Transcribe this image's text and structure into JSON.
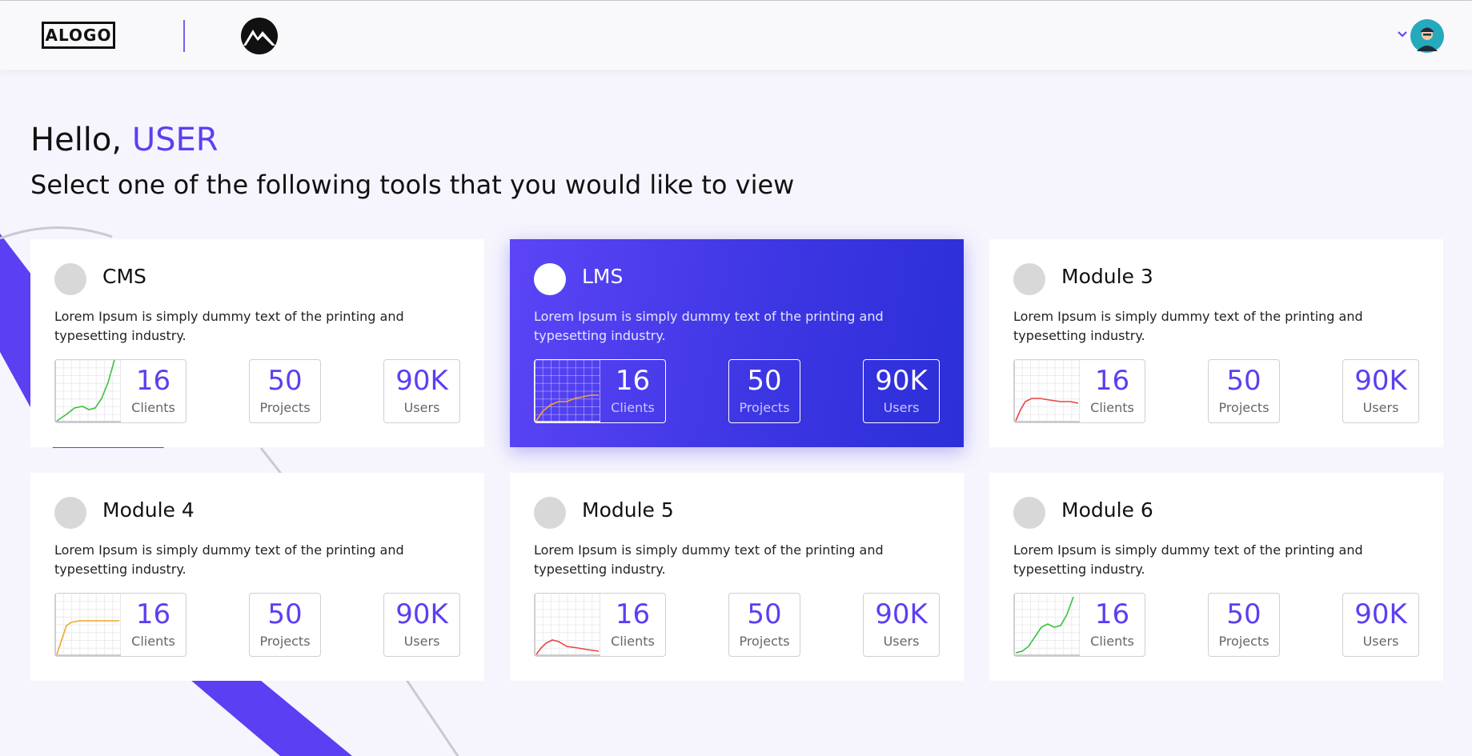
{
  "header": {
    "logo_text": "ALOGO",
    "icons": [
      "mountain-logo-icon",
      "chevron-down-icon",
      "user-avatar-icon"
    ]
  },
  "greeting": {
    "hello": "Hello,",
    "user": "USER",
    "subtitle": "Select one of the following tools that you would like to view"
  },
  "colors": {
    "accent": "#5b3ff2",
    "active_card_start": "#5c45f6",
    "active_card_end": "#2c2fd8",
    "background": "#f6f5fd"
  },
  "cards": [
    {
      "title": "CMS",
      "description": "Lorem Ipsum is simply dummy text of the printing and typesetting industry.",
      "active": false,
      "chart_color": "#3cc13c",
      "stats": {
        "clients_value": "16",
        "clients_label": "Clients",
        "projects_value": "50",
        "projects_label": "Projects",
        "users_value": "90K",
        "users_label": "Users"
      }
    },
    {
      "title": "LMS",
      "description": "Lorem Ipsum is simply dummy text of the printing and typesetting industry.",
      "active": true,
      "chart_color": "#f2a23a",
      "stats": {
        "clients_value": "16",
        "clients_label": "Clients",
        "projects_value": "50",
        "projects_label": "Projects",
        "users_value": "90K",
        "users_label": "Users"
      }
    },
    {
      "title": "Module 3",
      "description": "Lorem Ipsum is simply dummy text of the printing and typesetting industry.",
      "active": false,
      "chart_color": "#e84343",
      "stats": {
        "clients_value": "16",
        "clients_label": "Clients",
        "projects_value": "50",
        "projects_label": "Projects",
        "users_value": "90K",
        "users_label": "Users"
      }
    },
    {
      "title": "Module 4",
      "description": "Lorem Ipsum is simply dummy text of the printing and typesetting industry.",
      "active": false,
      "chart_color": "#f2a623",
      "stats": {
        "clients_value": "16",
        "clients_label": "Clients",
        "projects_value": "50",
        "projects_label": "Projects",
        "users_value": "90K",
        "users_label": "Users"
      }
    },
    {
      "title": "Module 5",
      "description": "Lorem Ipsum is simply dummy text of the printing and typesetting industry.",
      "active": false,
      "chart_color": "#e84343",
      "stats": {
        "clients_value": "16",
        "clients_label": "Clients",
        "projects_value": "50",
        "projects_label": "Projects",
        "users_value": "90K",
        "users_label": "Users"
      }
    },
    {
      "title": "Module 6",
      "description": "Lorem Ipsum is simply dummy text of the printing and typesetting industry.",
      "active": false,
      "chart_color": "#3cc13c",
      "stats": {
        "clients_value": "16",
        "clients_label": "Clients",
        "projects_value": "50",
        "projects_label": "Projects",
        "users_value": "90K",
        "users_label": "Users"
      }
    }
  ]
}
